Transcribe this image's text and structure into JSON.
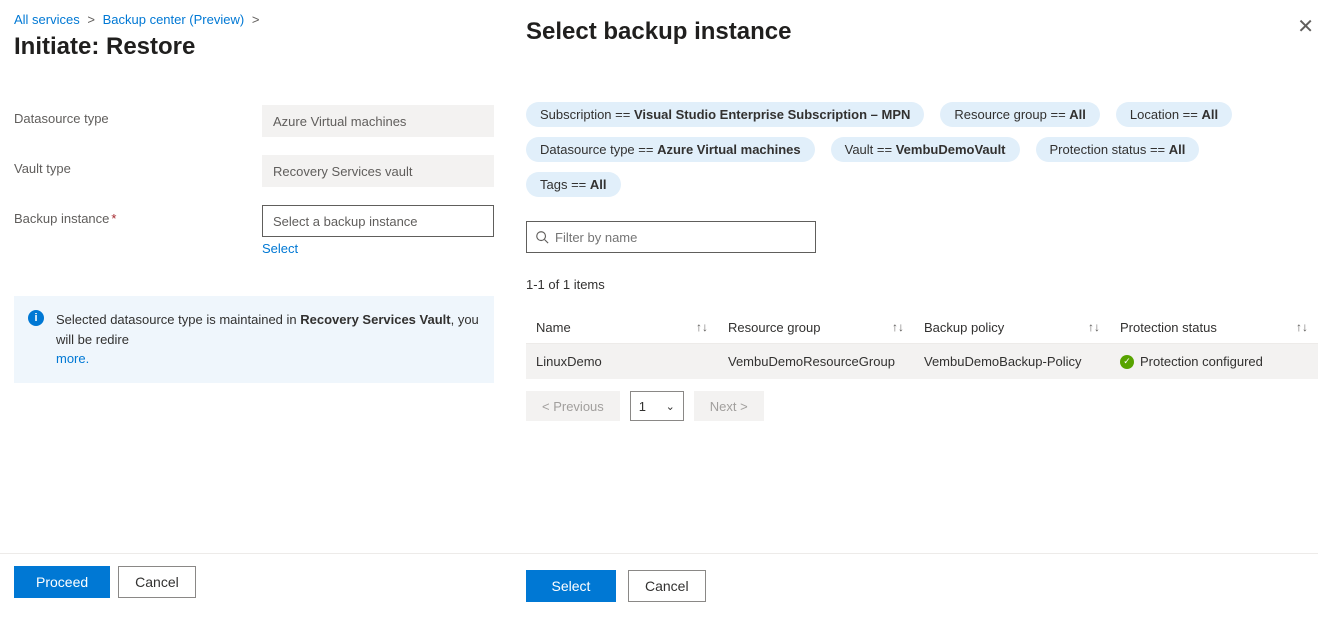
{
  "breadcrumb": {
    "items": [
      "All services",
      "Backup center (Preview)"
    ],
    "sep": ">"
  },
  "page_title": "Initiate: Restore",
  "form": {
    "datasource_label": "Datasource type",
    "datasource_value": "Azure Virtual machines",
    "vault_label": "Vault type",
    "vault_value": "Recovery Services vault",
    "backup_instance_label": "Backup instance",
    "backup_instance_placeholder": "Select a backup instance",
    "select_link": "Select"
  },
  "info": {
    "text_pre": "Selected datasource type is maintained in ",
    "text_bold": "Recovery Services Vault",
    "text_post": ", you will be redire",
    "more": "more."
  },
  "left_footer": {
    "proceed": "Proceed",
    "cancel": "Cancel"
  },
  "blade": {
    "title": "Select backup instance",
    "filters": {
      "subscription_key": "Subscription == ",
      "subscription_val": "Visual Studio Enterprise Subscription – MPN",
      "rg_key": "Resource group == ",
      "rg_val": "All",
      "loc_key": "Location == ",
      "loc_val": "All",
      "ds_key": "Datasource type == ",
      "ds_val": "Azure Virtual machines",
      "vault_key": "Vault == ",
      "vault_val": "VembuDemoVault",
      "prot_key": "Protection status == ",
      "prot_val": "All",
      "tags_key": "Tags == ",
      "tags_val": "All"
    },
    "filter_placeholder": "Filter by name",
    "count": "1-1 of 1 items",
    "columns": {
      "name": "Name",
      "rg": "Resource group",
      "policy": "Backup policy",
      "status": "Protection status"
    },
    "rows": [
      {
        "name": "LinuxDemo",
        "rg": "VembuDemoResourceGroup",
        "policy": "VembuDemoBackup-Policy",
        "status": "Protection configured"
      }
    ],
    "pager": {
      "prev": "< Previous",
      "page": "1",
      "next": "Next >"
    },
    "footer": {
      "select": "Select",
      "cancel": "Cancel"
    }
  },
  "sort_glyph": "↑↓"
}
